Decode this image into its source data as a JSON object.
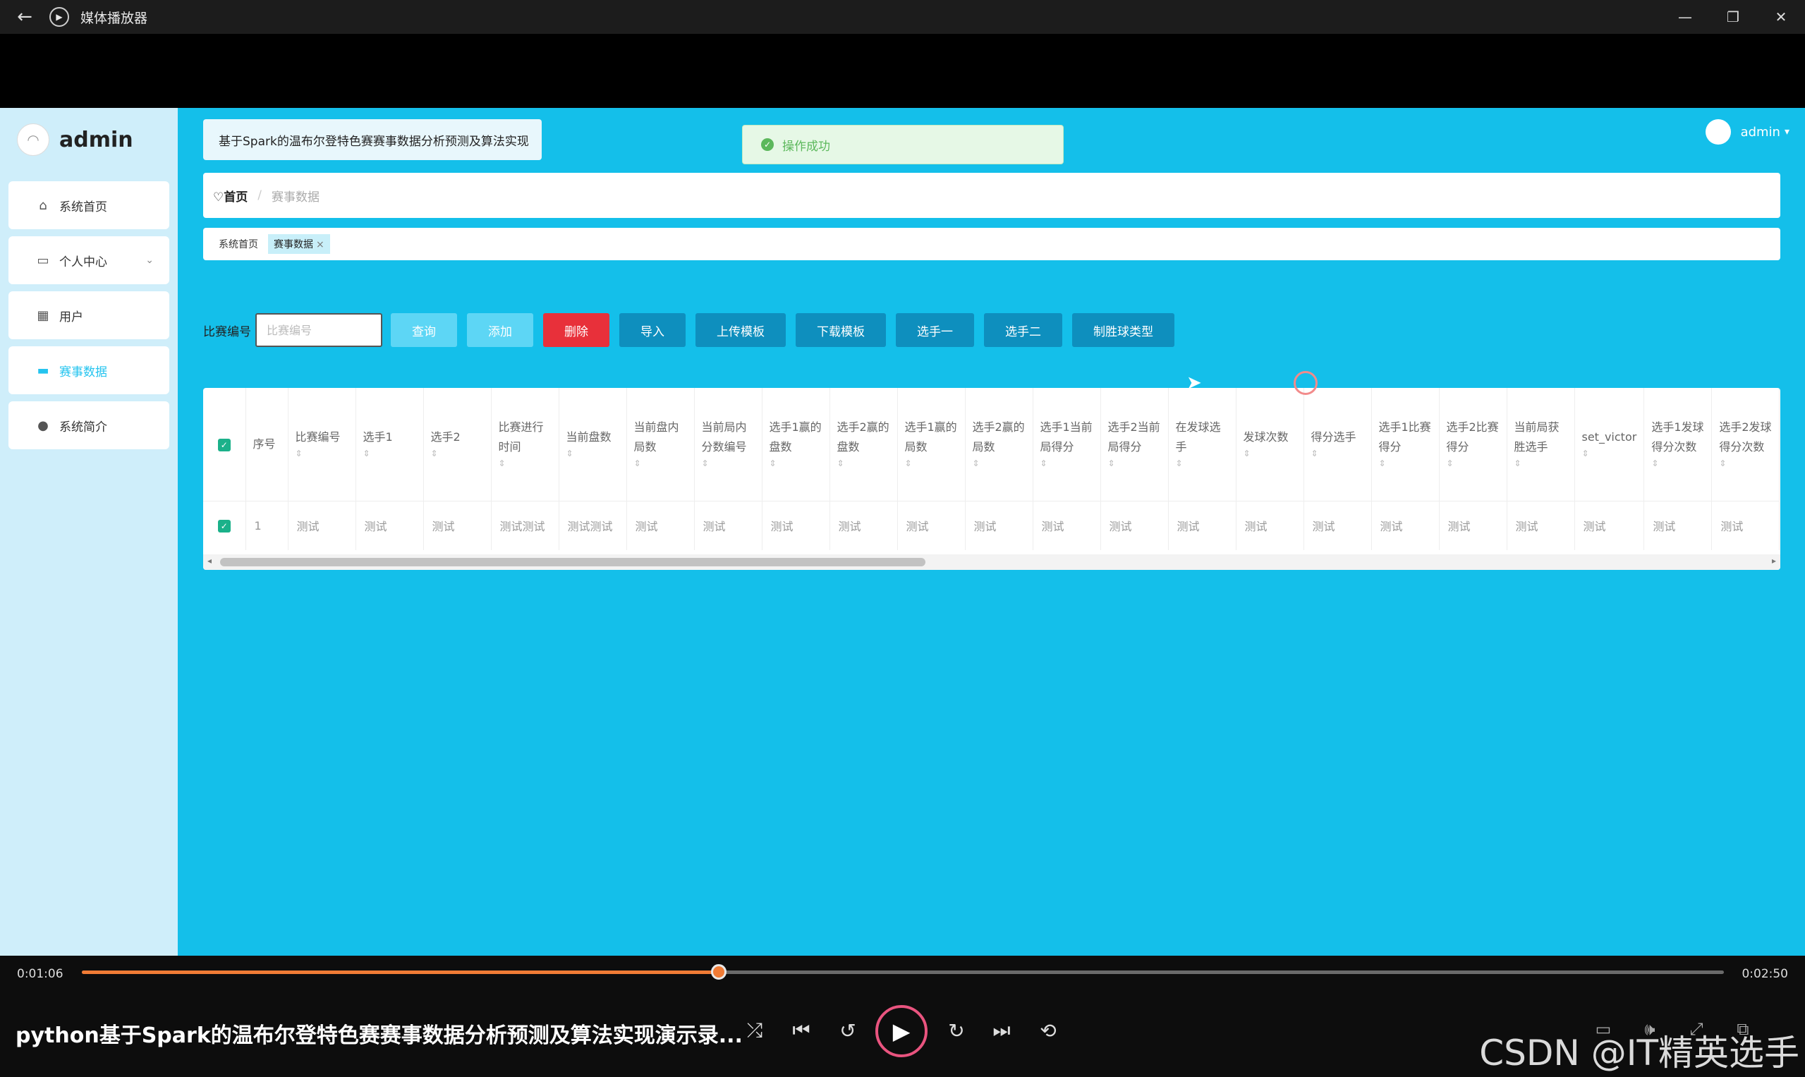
{
  "window": {
    "title": "媒体播放器",
    "back_icon": "←",
    "app_icon": "▶",
    "minimize": "—",
    "restore": "❐",
    "close": "✕"
  },
  "sidebar": {
    "brand": "admin",
    "items": [
      {
        "label": "系统首页",
        "icon": "⌂"
      },
      {
        "label": "个人中心",
        "icon": "▭",
        "chevron": "⌄"
      },
      {
        "label": "用户",
        "icon": "▦"
      },
      {
        "label": "赛事数据",
        "icon": "▬"
      },
      {
        "label": "系统简介",
        "icon": "●"
      }
    ]
  },
  "header": {
    "title": "基于Spark的温布尔登特色赛赛事数据分析预测及算法实现",
    "toast": "操作成功",
    "toast_icon": "✓",
    "user": "admin",
    "user_caret": "▾"
  },
  "breadcrumb": {
    "home": "♡首页",
    "sep": "/",
    "current": "赛事数据"
  },
  "tabs": [
    {
      "label": "系统首页"
    },
    {
      "label": "赛事数据",
      "close": "×"
    }
  ],
  "toolbar": {
    "label": "比赛编号",
    "placeholder": "比赛编号",
    "buttons": [
      "查询",
      "添加",
      "删除",
      "导入",
      "上传模板",
      "下载模板",
      "选手一",
      "选手二",
      "制胜球类型"
    ]
  },
  "table": {
    "check": "✓",
    "sort": "⇕",
    "columns": [
      "序号",
      "比赛编号",
      "选手1",
      "选手2",
      "比赛进行时间",
      "当前盘数",
      "当前盘内局数",
      "当前局内分数编号",
      "选手1赢的盘数",
      "选手2赢的盘数",
      "选手1赢的局数",
      "选手2赢的局数",
      "选手1当前局得分",
      "选手2当前局得分",
      "在发球选手",
      "发球次数",
      "得分选手",
      "选手1比赛得分",
      "选手2比赛得分",
      "当前局获胜选手",
      "set_victor",
      "选手1发球得分次数",
      "选手2发球得分次数"
    ],
    "rows": [
      [
        "1",
        "测试",
        "测试",
        "测试",
        "测试测试",
        "测试测试",
        "测试",
        "测试",
        "测试",
        "测试",
        "测试",
        "测试",
        "测试",
        "测试",
        "测试",
        "测试",
        "测试",
        "测试",
        "测试",
        "测试",
        "测试",
        "测试",
        "测试"
      ]
    ],
    "scroll_left": "◂",
    "scroll_right": "▸"
  },
  "player": {
    "elapsed": "0:01:06",
    "duration": "0:02:50",
    "progress": 0.388,
    "title": "python基于Spark的温布尔登特色赛赛事数据分析预测及算法实现演示录...",
    "shuffle": "⤮",
    "prev": "⏮",
    "back10": "↺",
    "play": "▶",
    "fwd30": "↻",
    "next": "⏭",
    "repeat": "⟲",
    "right_icons": [
      "▭",
      "🕪",
      "⤢",
      "⧉"
    ],
    "watermark": "CSDN @IT精英选手"
  }
}
